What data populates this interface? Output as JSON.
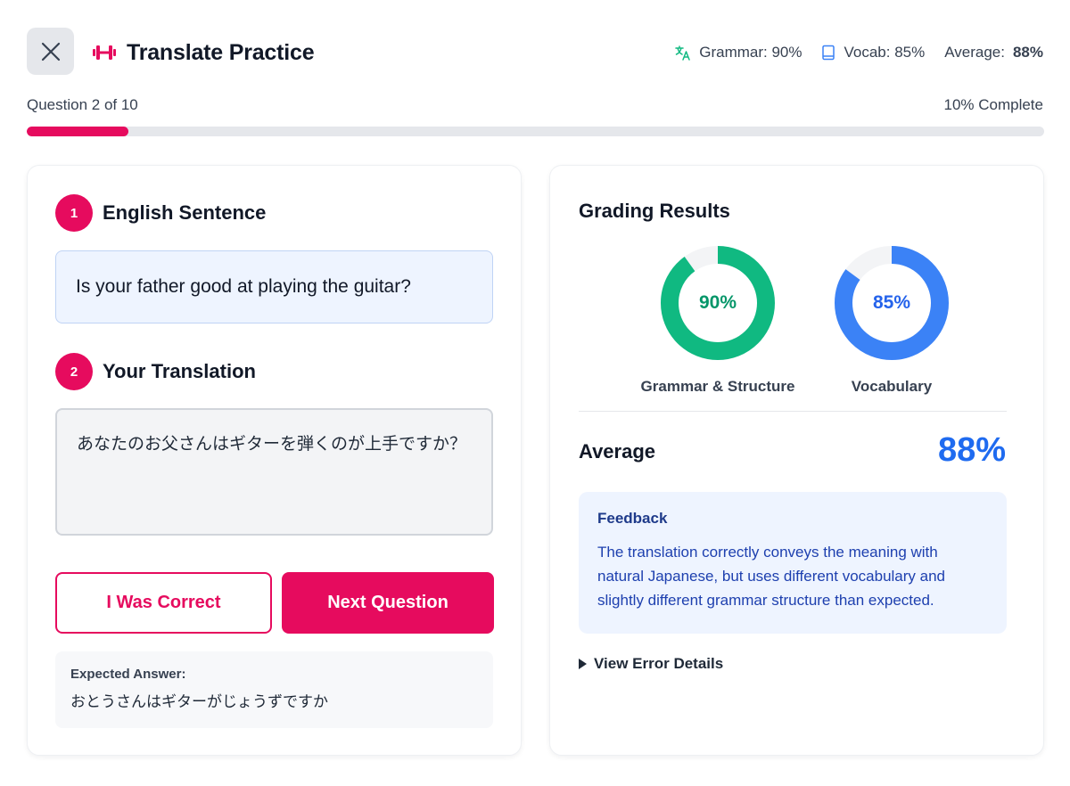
{
  "header": {
    "title": "Translate Practice",
    "logo_icon": "dumbbell-icon",
    "close_icon": "close-icon",
    "stats": {
      "grammar": "Grammar: 90%",
      "vocab": "Vocab: 85%",
      "average_label": "Average:",
      "average_value": "88%"
    }
  },
  "progress": {
    "question_label": "Question 2 of 10",
    "complete_label": "10% Complete",
    "fraction": 0.1
  },
  "left": {
    "step1": {
      "number": "1",
      "title": "English Sentence"
    },
    "sentence": "Is your father good at playing the guitar?",
    "step2": {
      "number": "2",
      "title": "Your Translation"
    },
    "translation": "あなたのお父さんはギターを弾くのが上手ですか？",
    "buttons": {
      "correct": "I Was Correct",
      "next": "Next Question"
    },
    "expected": {
      "label": "Expected Answer:",
      "text": "おとうさんはギターがじょうずですか"
    }
  },
  "right": {
    "title": "Grading Results",
    "grammar": {
      "value": 90,
      "display": "90%",
      "label": "Grammar & Structure",
      "color": "#10b981",
      "text_color": "#059669"
    },
    "vocab": {
      "value": 85,
      "display": "85%",
      "label": "Vocabulary",
      "color": "#3b82f6",
      "text_color": "#2563eb"
    },
    "average": {
      "label": "Average",
      "value": "88%"
    },
    "feedback": {
      "title": "Feedback",
      "text": "The translation correctly conveys the meaning with natural Japanese, but uses different vocabulary and slightly different grammar structure than expected."
    },
    "details_label": "View Error Details"
  },
  "colors": {
    "accent": "#e60b5e",
    "avg_blue": "#1f6bf0"
  }
}
